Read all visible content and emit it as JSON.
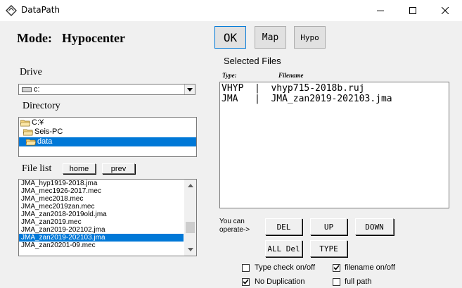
{
  "window": {
    "title": "DataPath",
    "controls": {
      "minimize": "minimize-icon",
      "maximize": "maximize-icon",
      "close": "close-icon"
    }
  },
  "mode": {
    "label": "Mode:",
    "value": "Hypocenter"
  },
  "buttons": {
    "ok": "OK",
    "map": "Map",
    "hypo": "Hypo"
  },
  "drive": {
    "label": "Drive",
    "value": "c:"
  },
  "directory": {
    "label": "Directory",
    "items": [
      {
        "name": "C:¥",
        "selected": false
      },
      {
        "name": "Seis-PC",
        "selected": false
      },
      {
        "name": "data",
        "selected": true
      }
    ]
  },
  "file_list": {
    "label": "File list",
    "home_label": "home",
    "prev_label": "prev",
    "items": [
      {
        "name": "JMA_hyp1919-2018.jma",
        "selected": false
      },
      {
        "name": "JMA_mec1926-2017.mec",
        "selected": false
      },
      {
        "name": "JMA_mec2018.mec",
        "selected": false
      },
      {
        "name": "JMA_mec2019zan.mec",
        "selected": false
      },
      {
        "name": "JMA_zan2018-2019old.jma",
        "selected": false
      },
      {
        "name": "JMA_zan2019.mec",
        "selected": false
      },
      {
        "name": "JMA_zan2019-202102.jma",
        "selected": false
      },
      {
        "name": "JMA_zan2019-202103.jma",
        "selected": true
      },
      {
        "name": "JMA_zan20201-09.mec",
        "selected": false
      }
    ]
  },
  "selected_files": {
    "title": "Selected Files",
    "col_type": "Type:",
    "col_filename": "Filename",
    "rows": [
      {
        "text": "VHYP  |  vhyp715-2018b.ruj"
      },
      {
        "text": "JMA   |  JMA_zan2019-202103.jma"
      }
    ]
  },
  "operate": {
    "label_line1": "You can",
    "label_line2": "operate->",
    "del": "DEL",
    "up": "UP",
    "down": "DOWN",
    "all_del": "ALL Del",
    "type": "TYPE"
  },
  "options": {
    "type_check": {
      "label": "Type check on/off",
      "checked": false
    },
    "filename": {
      "label": "filename on/off",
      "checked": true
    },
    "no_duplication": {
      "label": "No Duplication",
      "checked": true
    },
    "full_path": {
      "label": "full path",
      "checked": false
    }
  },
  "colors": {
    "selection": "#0078d7",
    "folder": "#f4d27a"
  }
}
